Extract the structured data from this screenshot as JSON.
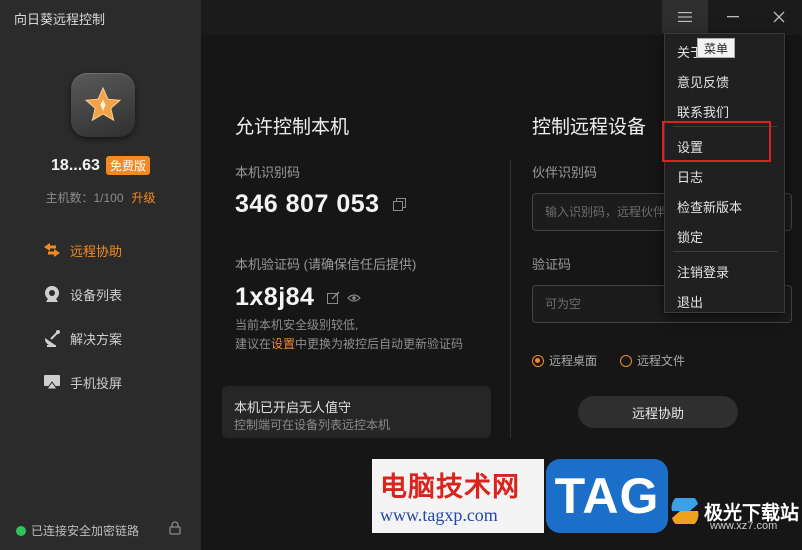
{
  "app": {
    "title": "向日葵远程控制"
  },
  "user": {
    "name": "18...63",
    "badge": "免费版",
    "host_count": "主机数：1/100",
    "upgrade": "升级"
  },
  "nav": [
    {
      "label": "远程协助",
      "icon": "remote-assist-icon",
      "active": true
    },
    {
      "label": "设备列表",
      "icon": "device-list-icon",
      "active": false
    },
    {
      "label": "解决方案",
      "icon": "solution-icon",
      "active": false
    },
    {
      "label": "手机投屏",
      "icon": "screen-cast-icon",
      "active": false
    }
  ],
  "status": {
    "text": "已连接安全加密链路"
  },
  "allow": {
    "title": "允许控制本机",
    "id_label": "本机识别码",
    "id_value": "346 807 053",
    "code_label": "本机验证码 (请确保信任后提供)",
    "code_value": "1x8j84",
    "hint_line1": "当前本机安全级别较低,",
    "hint_pre": "建议在",
    "hint_link": "设置",
    "hint_post": "中更换为被控后自动更新验证码",
    "unattended_title": "本机已开启无人值守",
    "unattended_sub": "控制端可在设备列表远控本机"
  },
  "control": {
    "title": "控制远程设备",
    "partner_label": "伙伴识别码",
    "partner_placeholder": "输入识别码，远程伙伴",
    "code_label": "验证码",
    "code_placeholder": "可为空",
    "radio_desktop": "远程桌面",
    "radio_file": "远程文件",
    "button": "远程协助"
  },
  "menu": {
    "tooltip": "菜单",
    "items": [
      "关于",
      "意见反馈",
      "联系我们",
      "设置",
      "日志",
      "检查新版本",
      "锁定",
      "注销登录",
      "退出"
    ]
  },
  "watermark": {
    "title": "电脑技术网",
    "url": "www.tagxp.com",
    "tag": "TAG",
    "brand": "极光下载站",
    "brand_url": "www.xz7.com"
  },
  "colors": {
    "accent": "#f08a24",
    "sidebar": "#2b2b2b",
    "main": "#161616",
    "highlight": "#e02020",
    "status_ok": "#2fc35b"
  }
}
